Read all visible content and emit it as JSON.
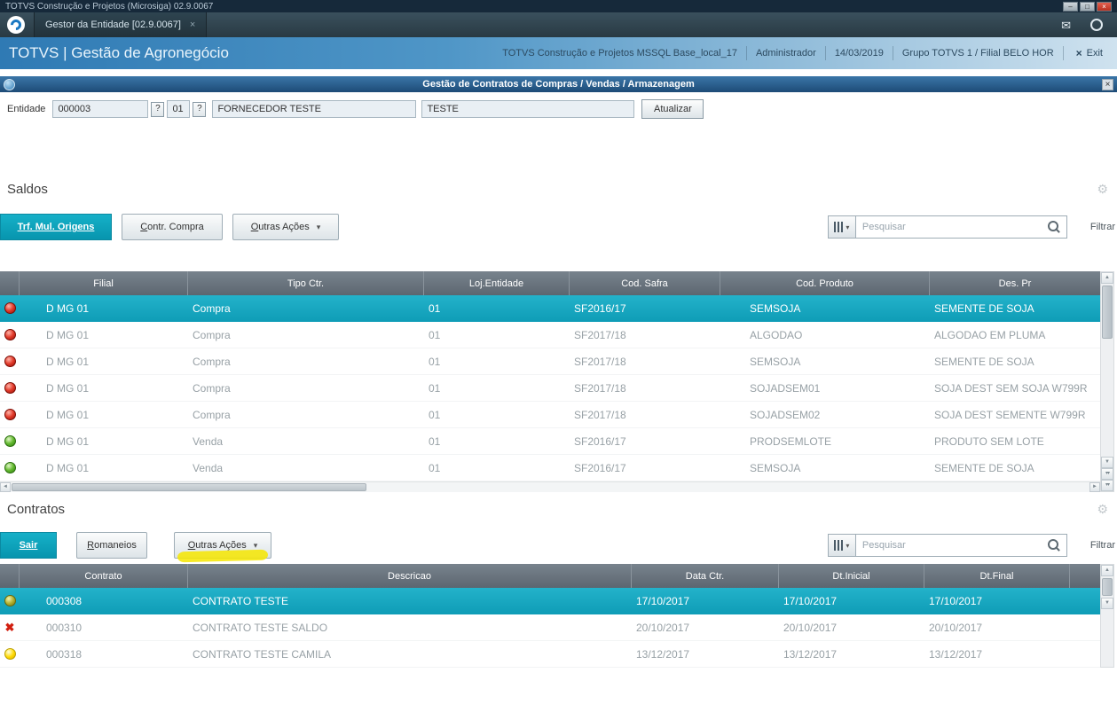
{
  "window": {
    "title": "TOTVS Construção e Projetos (Microsiga) 02.9.0067"
  },
  "tabbar": {
    "active_tab": "Gestor da Entidade [02.9.0067]"
  },
  "header": {
    "brand": "TOTVS | Gestão de Agronegócio",
    "environment": "TOTVS Construção e Projetos MSSQL Base_local_17",
    "user": "Administrador",
    "date": "14/03/2019",
    "group": "Grupo TOTVS 1 / Filial BELO HOR",
    "exit_label": "Exit"
  },
  "dialog": {
    "title": "Gestão de Contratos de Compras / Vendas / Armazenagem"
  },
  "form": {
    "label": "Entidade",
    "entity_code": "000003",
    "store_code": "01",
    "lookup": "?",
    "entity_name": "FORNECEDOR TESTE",
    "entity_alias": "TESTE",
    "update_button": "Atualizar"
  },
  "saldos": {
    "title": "Saldos",
    "toolbar": {
      "primary_button": "Trf. Mul. Origens",
      "button2": "Contr. Compra",
      "button3": "Outras Ações",
      "search_placeholder": "Pesquisar",
      "filter_label": "Filtrar"
    },
    "columns": [
      "Filial",
      "Tipo Ctr.",
      "Loj.Entidade",
      "Cod. Safra",
      "Cod. Produto",
      "Des. Pr"
    ],
    "rows": [
      {
        "status": "red",
        "filial": "D MG 01",
        "tipo": "Compra",
        "loj": "01",
        "safra": "SF2016/17",
        "produto": "SEMSOJA",
        "descricao": "SEMENTE DE SOJA"
      },
      {
        "status": "red",
        "filial": "D MG 01",
        "tipo": "Compra",
        "loj": "01",
        "safra": "SF2017/18",
        "produto": "ALGODAO",
        "descricao": "ALGODAO EM PLUMA"
      },
      {
        "status": "red",
        "filial": "D MG 01",
        "tipo": "Compra",
        "loj": "01",
        "safra": "SF2017/18",
        "produto": "SEMSOJA",
        "descricao": "SEMENTE DE SOJA"
      },
      {
        "status": "red",
        "filial": "D MG 01",
        "tipo": "Compra",
        "loj": "01",
        "safra": "SF2017/18",
        "produto": "SOJADSEM01",
        "descricao": "SOJA DEST SEM SOJA W799R"
      },
      {
        "status": "red",
        "filial": "D MG 01",
        "tipo": "Compra",
        "loj": "01",
        "safra": "SF2017/18",
        "produto": "SOJADSEM02",
        "descricao": "SOJA DEST SEMENTE W799R"
      },
      {
        "status": "green",
        "filial": "D MG 01",
        "tipo": "Venda",
        "loj": "01",
        "safra": "SF2016/17",
        "produto": "PRODSEMLOTE",
        "descricao": "PRODUTO SEM LOTE"
      },
      {
        "status": "green",
        "filial": "D MG 01",
        "tipo": "Venda",
        "loj": "01",
        "safra": "SF2016/17",
        "produto": "SEMSOJA",
        "descricao": "SEMENTE DE SOJA"
      }
    ]
  },
  "contratos": {
    "title": "Contratos",
    "toolbar": {
      "primary_button": "Sair",
      "button2": "Romaneios",
      "button3": "Outras Ações",
      "search_placeholder": "Pesquisar",
      "filter_label": "Filtrar"
    },
    "columns": [
      "Contrato",
      "Descricao",
      "Data Ctr.",
      "Dt.Inicial",
      "Dt.Final"
    ],
    "rows": [
      {
        "status": "olive",
        "contrato": "000308",
        "descricao": "CONTRATO TESTE",
        "data_ctr": "17/10/2017",
        "dt_inicial": "17/10/2017",
        "dt_final": "17/10/2017"
      },
      {
        "status": "red-x",
        "contrato": "000310",
        "descricao": "CONTRATO TESTE SALDO",
        "data_ctr": "20/10/2017",
        "dt_inicial": "20/10/2017",
        "dt_final": "20/10/2017"
      },
      {
        "status": "yellow",
        "contrato": "000318",
        "descricao": "CONTRATO TESTE CAMILA",
        "data_ctr": "13/12/2017",
        "dt_inicial": "13/12/2017",
        "dt_final": "13/12/2017"
      }
    ]
  },
  "icons": {
    "chevron_down": "▾",
    "gear": "⚙",
    "envelope": "✉",
    "minimize": "–",
    "maximize": "□",
    "close": "×",
    "arrow_up": "▲",
    "arrow_down": "▼",
    "arrow_left": "◄",
    "arrow_right": "►",
    "double_down": "▾▾"
  },
  "colors": {
    "accent_teal": "#0f9db7",
    "header_blue": "#2f7ab4",
    "status_red": "#e23a2a",
    "status_green": "#63b92f",
    "status_yellow": "#ffd900",
    "highlight_yellow": "#f6e600"
  }
}
